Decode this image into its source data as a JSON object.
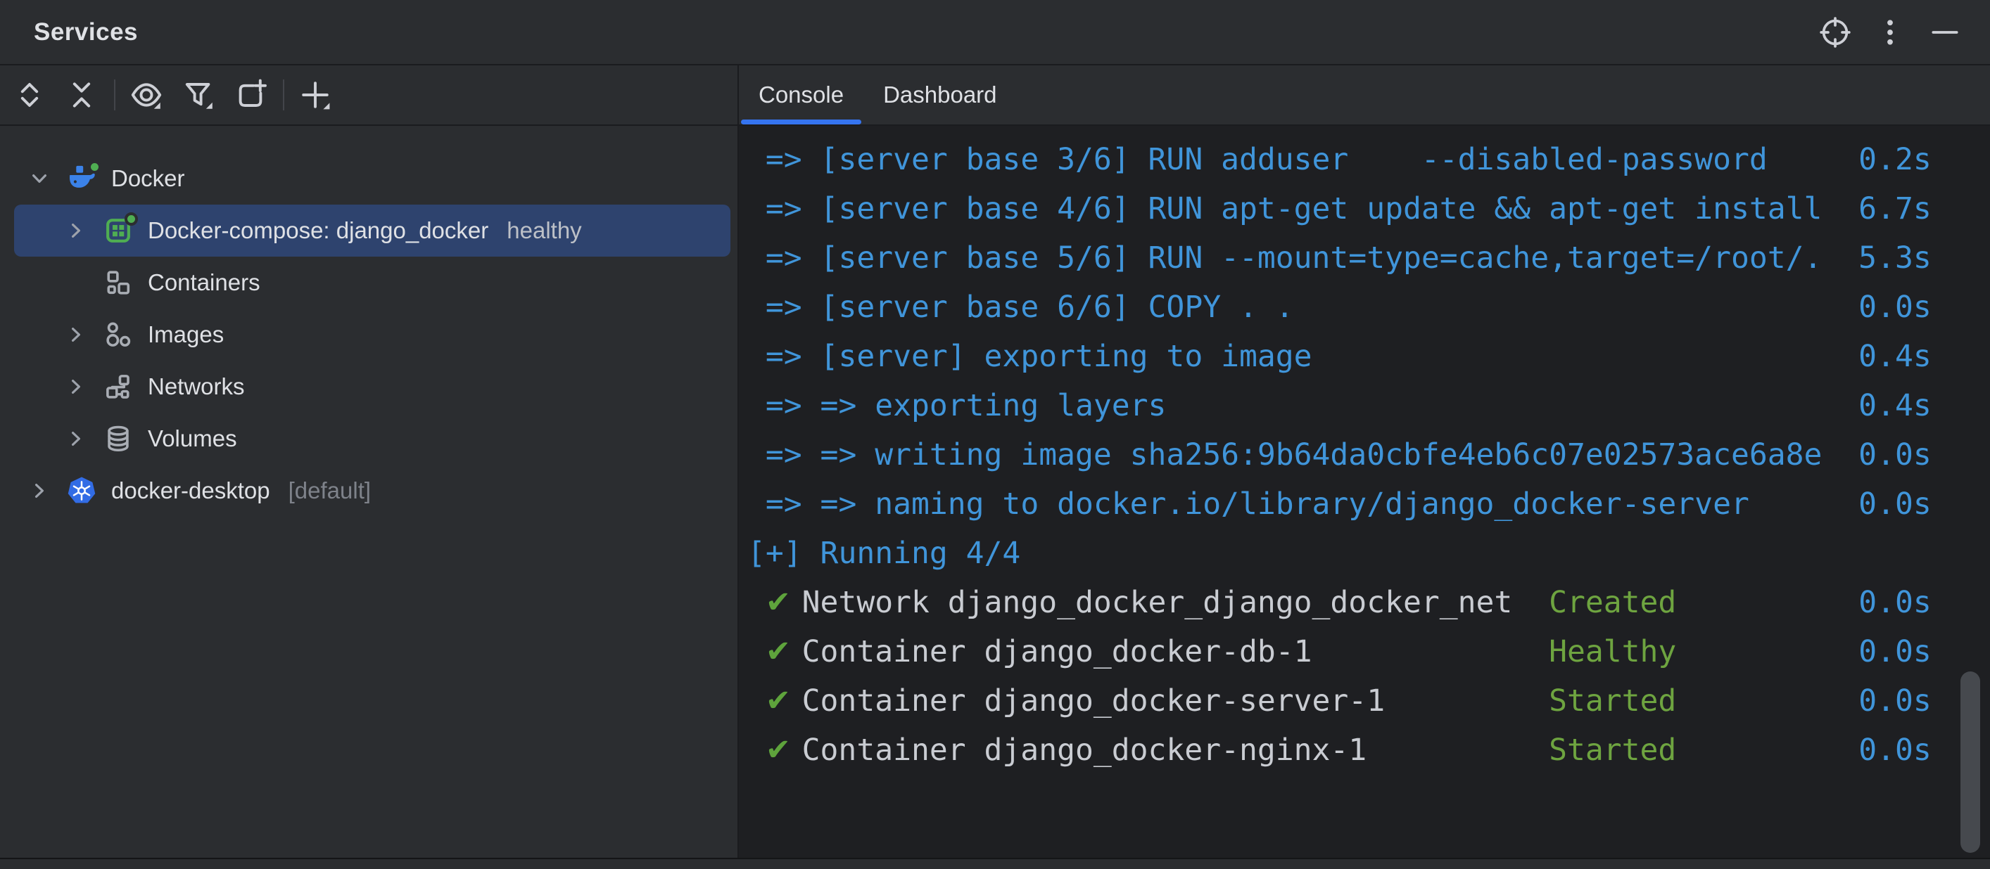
{
  "window": {
    "title": "Services"
  },
  "titlebar": {
    "icons": [
      "target-icon",
      "more-options-icon",
      "minimize-icon"
    ]
  },
  "toolbar": {
    "icons": [
      "expand-all-icon",
      "collapse-all-icon",
      "separator",
      "view-options-icon",
      "filter-icon",
      "open-in-new-tab-icon",
      "separator",
      "add-service-icon"
    ]
  },
  "colors": {
    "panel_bg": "#2b2d30",
    "console_bg": "#1e1f22",
    "divider": "#1a1b1e",
    "selection_bg": "#2e436e",
    "tab_accent": "#3574f0",
    "console_blue": "#4095da",
    "console_green": "#6ea440",
    "console_fg": "#c9ccd2",
    "docker_blue": "#3b82e8",
    "compose_green": "#4fae52",
    "kubernetes_blue": "#326ce5",
    "status_dot_green": "#4fae52"
  },
  "tree": {
    "items": [
      {
        "id": "docker",
        "level": 0,
        "chevron": "down",
        "icon": "docker-icon",
        "label": "Docker",
        "suffix": "",
        "suffix_style": "",
        "status_dot": true,
        "selected": false
      },
      {
        "id": "docker-compose",
        "level": 1,
        "chevron": "right",
        "icon": "docker-compose-icon",
        "label": "Docker-compose: django_docker",
        "suffix": "healthy",
        "suffix_style": "dim",
        "status_dot": true,
        "selected": true
      },
      {
        "id": "containers",
        "level": 1,
        "chevron": "none",
        "icon": "containers-icon",
        "label": "Containers",
        "suffix": "",
        "suffix_style": "",
        "status_dot": false,
        "selected": false
      },
      {
        "id": "images",
        "level": 1,
        "chevron": "right",
        "icon": "images-icon",
        "label": "Images",
        "suffix": "",
        "suffix_style": "",
        "status_dot": false,
        "selected": false
      },
      {
        "id": "networks",
        "level": 1,
        "chevron": "right",
        "icon": "networks-icon",
        "label": "Networks",
        "suffix": "",
        "suffix_style": "",
        "status_dot": false,
        "selected": false
      },
      {
        "id": "volumes",
        "level": 1,
        "chevron": "right",
        "icon": "volumes-icon",
        "label": "Volumes",
        "suffix": "",
        "suffix_style": "",
        "status_dot": false,
        "selected": false
      },
      {
        "id": "docker-desktop",
        "level": 0,
        "chevron": "right",
        "icon": "kubernetes-icon",
        "label": "docker-desktop",
        "suffix": "[default]",
        "suffix_style": "gray",
        "status_dot": false,
        "selected": false
      }
    ]
  },
  "tabs": [
    {
      "label": "Console",
      "active": true
    },
    {
      "label": "Dashboard",
      "active": false
    }
  ],
  "console": {
    "lines": [
      {
        "segs": [
          {
            "s": "blue",
            "t": " => [server base 3/6] RUN adduser    --disabled-password     0.2s"
          }
        ]
      },
      {
        "segs": [
          {
            "s": "blue",
            "t": " => [server base 4/6] RUN apt-get update && apt-get install  6.7s"
          }
        ]
      },
      {
        "segs": [
          {
            "s": "blue",
            "t": " => [server base 5/6] RUN --mount=type=cache,target=/root/.  5.3s"
          }
        ]
      },
      {
        "segs": [
          {
            "s": "blue",
            "t": " => [server base 6/6] COPY . .                               0.0s"
          }
        ]
      },
      {
        "segs": [
          {
            "s": "blue",
            "t": " => [server] exporting to image                              0.4s"
          }
        ]
      },
      {
        "segs": [
          {
            "s": "blue",
            "t": " => => exporting layers                                      0.4s"
          }
        ]
      },
      {
        "segs": [
          {
            "s": "blue",
            "t": " => => writing image sha256:9b64da0cbfe4eb6c07e02573ace6a8e  0.0s"
          }
        ]
      },
      {
        "segs": [
          {
            "s": "blue",
            "t": " => => naming to docker.io/library/django_docker-server      0.0s"
          }
        ]
      },
      {
        "segs": [
          {
            "s": "blue",
            "t": "[+] Running 4/4"
          }
        ]
      },
      {
        "segs": [
          {
            "s": "fg",
            "t": " "
          },
          {
            "s": "check",
            "t": "✔"
          },
          {
            "s": "fg",
            "t": " Network django_docker_django_docker_net  "
          },
          {
            "s": "green",
            "t": "Created"
          },
          {
            "s": "fg",
            "t": "          "
          },
          {
            "s": "blue",
            "t": "0.0s"
          }
        ]
      },
      {
        "segs": [
          {
            "s": "fg",
            "t": " "
          },
          {
            "s": "check",
            "t": "✔"
          },
          {
            "s": "fg",
            "t": " Container django_docker-db-1             "
          },
          {
            "s": "green",
            "t": "Healthy"
          },
          {
            "s": "fg",
            "t": "          "
          },
          {
            "s": "blue",
            "t": "0.0s"
          }
        ]
      },
      {
        "segs": [
          {
            "s": "fg",
            "t": " "
          },
          {
            "s": "check",
            "t": "✔"
          },
          {
            "s": "fg",
            "t": " Container django_docker-server-1         "
          },
          {
            "s": "green",
            "t": "Started"
          },
          {
            "s": "fg",
            "t": "          "
          },
          {
            "s": "blue",
            "t": "0.0s"
          }
        ]
      },
      {
        "segs": [
          {
            "s": "fg",
            "t": " "
          },
          {
            "s": "check",
            "t": "✔"
          },
          {
            "s": "fg",
            "t": " Container django_docker-nginx-1          "
          },
          {
            "s": "green",
            "t": "Started"
          },
          {
            "s": "fg",
            "t": "          "
          },
          {
            "s": "blue",
            "t": "0.0s"
          }
        ]
      }
    ]
  }
}
